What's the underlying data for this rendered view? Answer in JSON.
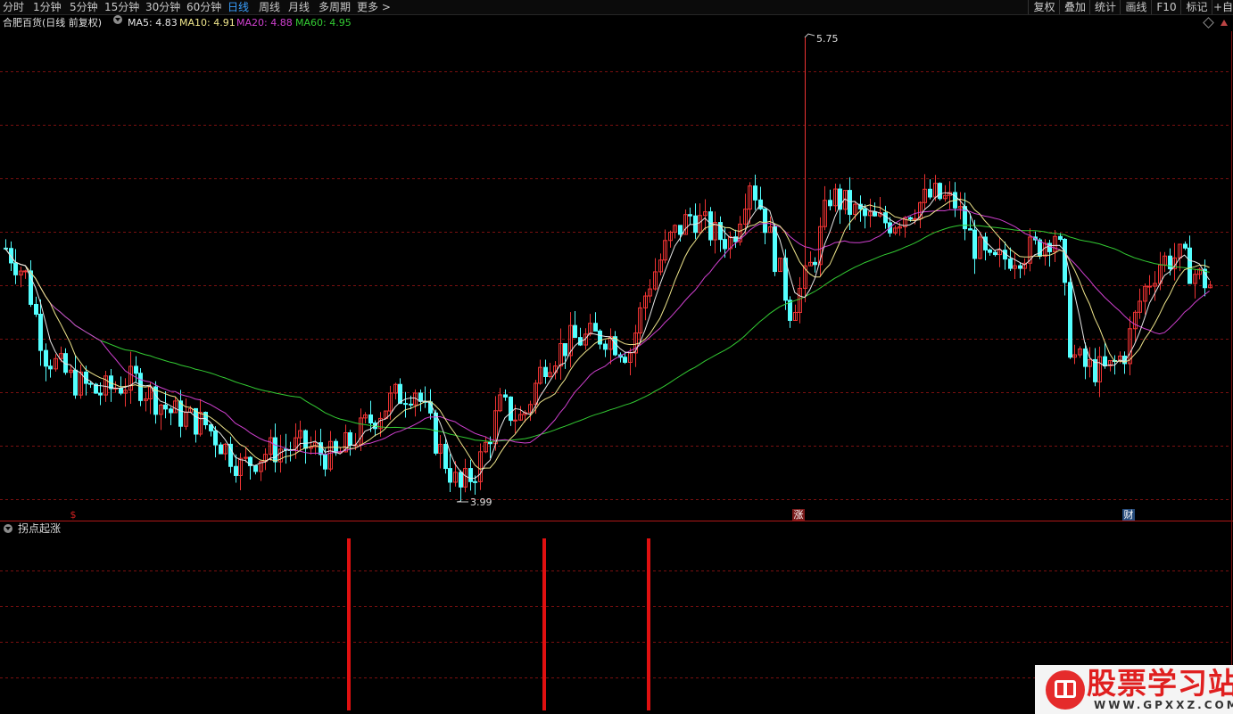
{
  "toolbar": {
    "periods": [
      "分时",
      "1分钟",
      "5分钟",
      "15分钟",
      "30分钟",
      "60分钟",
      "日线",
      "周线",
      "月线",
      "多周期",
      "更多 >"
    ],
    "active_period": "日线",
    "right_tools": [
      "复权",
      "叠加",
      "统计",
      "画线",
      "F10",
      "标记",
      "+自"
    ]
  },
  "chart": {
    "stock_title": "合肥百货(日线 前复权)",
    "ma_values": [
      {
        "label": "MA5: 4.83",
        "color": "#e6e6e6"
      },
      {
        "label": "MA10: 4.91",
        "color": "#f0e68c"
      },
      {
        "label": "MA20: 4.88",
        "color": "#d040d0"
      },
      {
        "label": "MA60: 4.95",
        "color": "#33cc33"
      }
    ],
    "high_label": "5.75",
    "low_label": "3.99",
    "markers": [
      {
        "text": "$",
        "color": "#d02020"
      },
      {
        "text": "涨",
        "color": "#ffffff",
        "bg": "#7a1a1a"
      },
      {
        "text": "财",
        "color": "#ffffff",
        "bg": "#244a7a"
      }
    ]
  },
  "indicator": {
    "title": "拐点起涨",
    "signal_color": "#e01010",
    "signals": 3
  },
  "colors": {
    "up": "#ee3333",
    "down": "#54ffff",
    "grid": "#7a1010",
    "ma5": "#e6e6e6",
    "ma10": "#f0e68c",
    "ma20": "#d040d0",
    "ma60": "#33cc33"
  },
  "watermark": {
    "title": "股票学习站",
    "url": "WWW.GPXXZ.COM"
  }
}
